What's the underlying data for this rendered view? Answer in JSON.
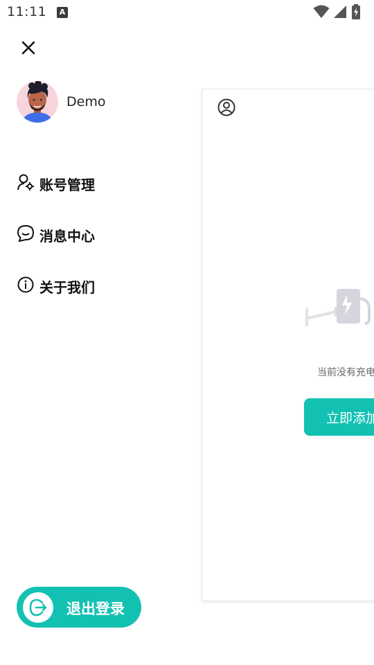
{
  "status_bar": {
    "time": "11:11",
    "notification_icon": "A"
  },
  "drawer": {
    "close_icon": "close-icon",
    "profile": {
      "name": "Demo",
      "avatar": "avatar-illustration"
    },
    "menu": [
      {
        "label": "账号管理",
        "icon": "user-settings-icon"
      },
      {
        "label": "消息中心",
        "icon": "message-icon"
      },
      {
        "label": "关于我们",
        "icon": "info-icon"
      }
    ],
    "logout": {
      "label": "退出登录",
      "icon": "logout-icon"
    }
  },
  "background_page": {
    "empty_text": "当前没有充电",
    "add_button": "立即添加"
  },
  "colors": {
    "accent": "#13c1b3",
    "text": "#111111",
    "muted": "#666666"
  }
}
